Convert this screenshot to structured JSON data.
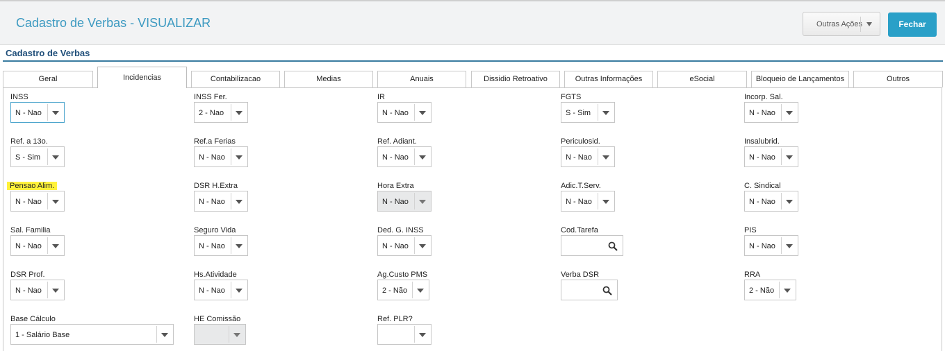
{
  "header": {
    "title": "Cadastro de Verbas - VISUALIZAR",
    "more_actions_label": "Outras Ações",
    "close_label": "Fechar"
  },
  "section_title": "Cadastro de Verbas",
  "tabs": [
    {
      "label": "Geral"
    },
    {
      "label": "Incidencias",
      "active": true
    },
    {
      "label": "Contabilizacao"
    },
    {
      "label": "Medias"
    },
    {
      "label": "Anuais"
    },
    {
      "label": "Dissidio Retroativo"
    },
    {
      "label": "Outras Informações"
    },
    {
      "label": "eSocial"
    },
    {
      "label": "Bloqueio de Lançamentos"
    },
    {
      "label": "Outros"
    }
  ],
  "fields": [
    {
      "label": "INSS",
      "value": "N - Nao"
    },
    {
      "label": "INSS Fer.",
      "value": "2 - Nao"
    },
    {
      "label": "IR",
      "value": "N - Nao"
    },
    {
      "label": "FGTS",
      "value": "S - Sim"
    },
    {
      "label": "Incorp. Sal.",
      "value": "N - Nao"
    },
    {
      "label": "Ref. a 13o.",
      "value": "S - Sim"
    },
    {
      "label": "Ref.a Ferias",
      "value": "N - Nao"
    },
    {
      "label": "Ref. Adiant.",
      "value": "N - Nao"
    },
    {
      "label": "Periculosid.",
      "value": "N - Nao"
    },
    {
      "label": "Insalubrid.",
      "value": "N - Nao"
    },
    {
      "label": "Pensao Alim.",
      "value": "N - Nao",
      "highlighted": true
    },
    {
      "label": "DSR H.Extra",
      "value": "N - Nao"
    },
    {
      "label": "Hora Extra",
      "value": "N - Nao",
      "disabled": true
    },
    {
      "label": "Adic.T.Serv.",
      "value": "N - Nao"
    },
    {
      "label": "C. Sindical",
      "value": "N - Nao"
    },
    {
      "label": "Sal. Familia",
      "value": "N - Nao"
    },
    {
      "label": "Seguro Vida",
      "value": "N - Nao"
    },
    {
      "label": "Ded. G. INSS",
      "value": "N - Nao"
    },
    {
      "label": "Cod.Tarefa",
      "value": ""
    },
    {
      "label": "PIS",
      "value": "N - Nao"
    },
    {
      "label": "DSR Prof.",
      "value": "N - Nao"
    },
    {
      "label": "Hs.Atividade",
      "value": "N - Nao"
    },
    {
      "label": "Ag.Custo PMS",
      "value": "2 - Não"
    },
    {
      "label": "Verba DSR",
      "value": ""
    },
    {
      "label": "RRA",
      "value": "2 - Não"
    },
    {
      "label": "Base Cálculo",
      "value": "1 - Salário Base"
    },
    {
      "label": "HE Comissão",
      "value": "",
      "disabled": true
    },
    {
      "label": "Ref. PLR?",
      "value": ""
    }
  ],
  "icons": {
    "lookup": "search-icon",
    "dropdown": "chevron-down-icon"
  },
  "colors": {
    "title": "#3d9ac1",
    "primary_button": "#2aa0c8",
    "highlight": "#fff23a",
    "section": "#1f4e79"
  }
}
